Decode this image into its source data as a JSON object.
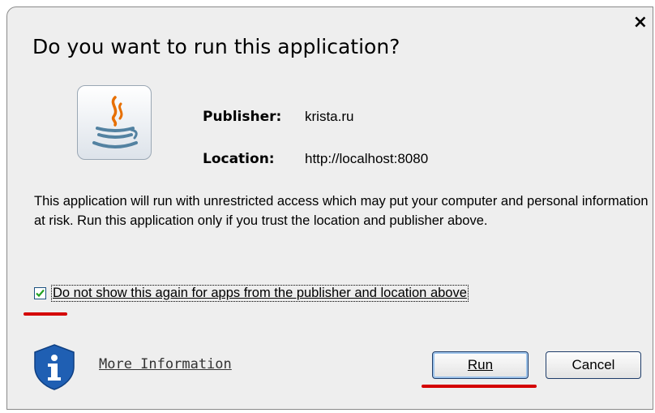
{
  "dialog": {
    "title": "Do you want to run this application?",
    "close_symbol": "×"
  },
  "app_icon": "java-coffee-cup-icon",
  "publisher": {
    "label": "Publisher:",
    "value": "krista.ru"
  },
  "location": {
    "label": "Location:",
    "value": "http://localhost:8080"
  },
  "warning_text": "This application will run with unrestricted access which may put your computer and personal information at risk. Run this application only if you trust the location and publisher above.",
  "checkbox": {
    "checked": true,
    "label": "Do not show this again for apps from the publisher and location above"
  },
  "more_info": {
    "icon": "info-shield-icon",
    "label": "More Information"
  },
  "buttons": {
    "run": "Run",
    "cancel": "Cancel"
  },
  "colors": {
    "highlight_mark": "#d40000",
    "info_shield": "#1f5fb3",
    "java_orange": "#e76f00",
    "java_blue": "#5382a1"
  }
}
